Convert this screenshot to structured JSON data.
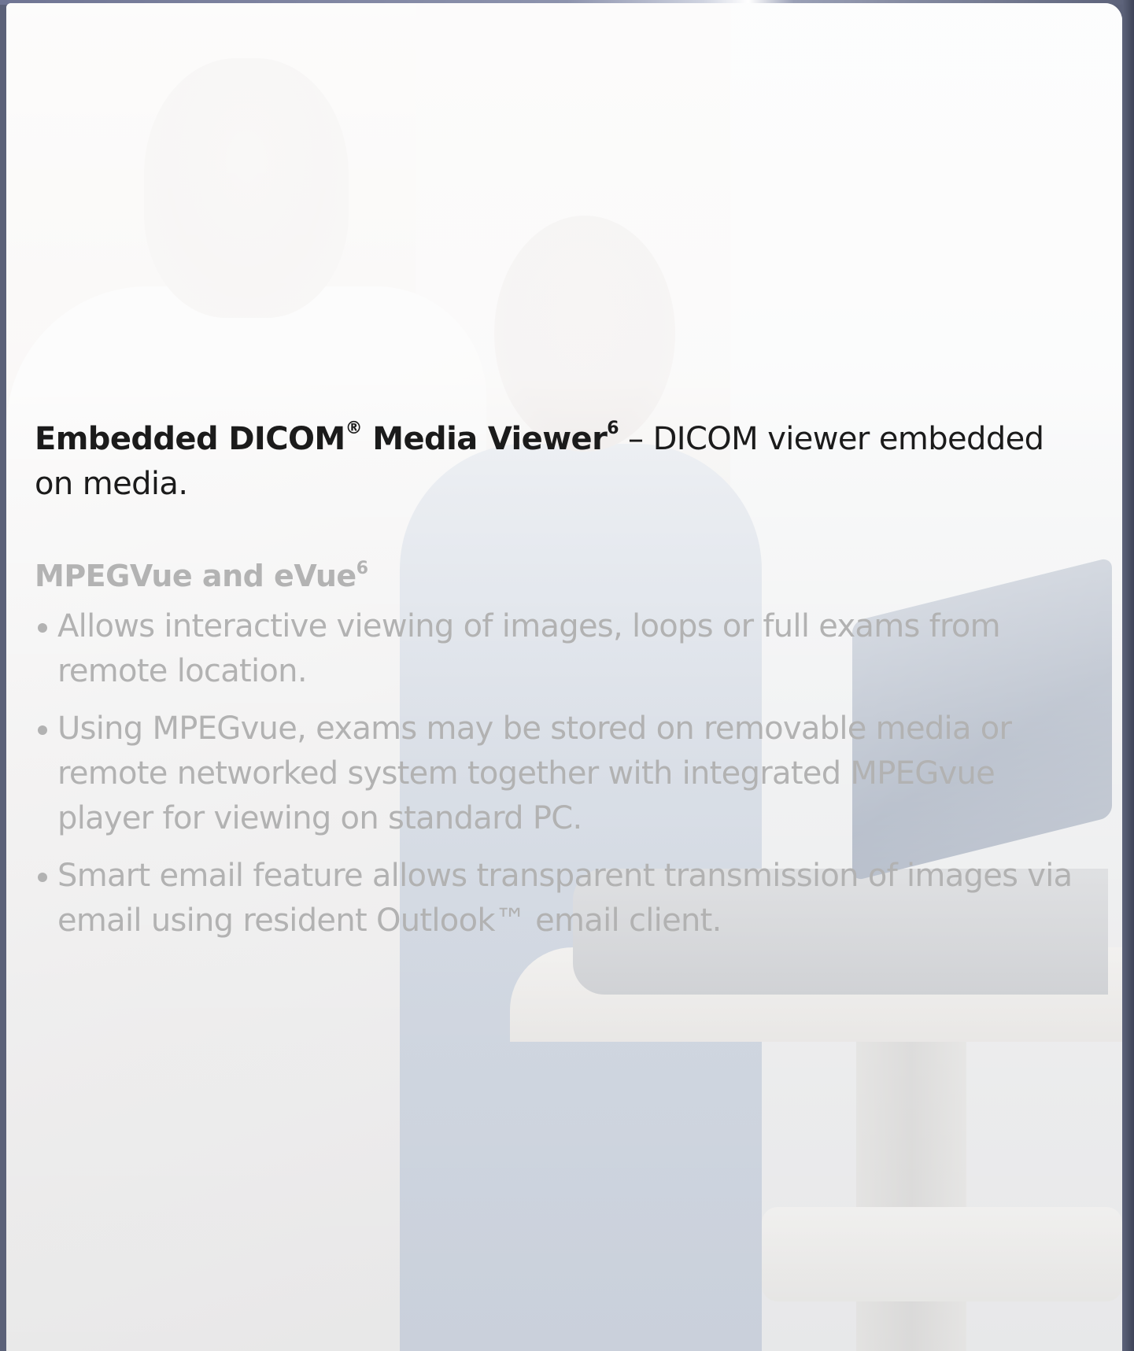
{
  "intro": {
    "bold_text": "Embedded DICOM",
    "registered": "®",
    "bold_text_2": " Media Viewer",
    "footnote": "6",
    "rest": " – DICOM viewer embedded on media."
  },
  "section": {
    "title": "MPEGVue and eVue",
    "footnote": "6",
    "bullets": [
      "Allows interactive viewing of images, loops or full exams from remote location.",
      "Using MPEGvue, exams may be stored on removable media or remote networked system together with integrated MPEGvue player for viewing on standard PC.",
      "Smart email feature allows transparent transmission of images via email using resident Outlook™ email client."
    ]
  },
  "colors": {
    "frame": "#5b6178",
    "body_text": "#1b1b1b",
    "faded_text": "#b2b2b2"
  }
}
